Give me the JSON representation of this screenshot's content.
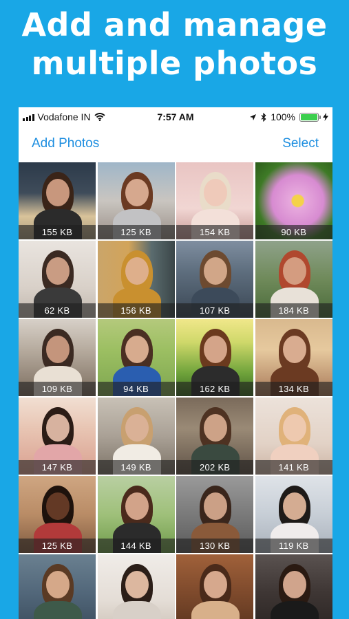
{
  "headline": {
    "line1": "Add and manage",
    "line2": "multiple photos"
  },
  "status_bar": {
    "carrier": "Vodafone IN",
    "time": "7:57 AM",
    "battery": "100%"
  },
  "nav": {
    "left_label": "Add Photos",
    "right_label": "Select"
  },
  "photos": [
    {
      "size": "155 KB",
      "bg": "linear-gradient(180deg,#2c3a4a 0%,#3f4c5a 40%,#d9c39a 70%,#a89a7c 100%)",
      "skin": "#d8a488",
      "hair": "#3a2418",
      "top": "#2b2b2b"
    },
    {
      "size": "125 KB",
      "bg": "linear-gradient(180deg,#9fb6c8 0%,#c9c5c0 50%,#9a8f88 100%)",
      "skin": "#e2b59a",
      "hair": "#6b3a22",
      "top": "#c2c2c4"
    },
    {
      "size": "154 KB",
      "bg": "linear-gradient(180deg,#e9c5c3 0%,#f1d6d3 60%,#c79a96 100%)",
      "skin": "#f0c8b8",
      "hair": "#e9dcc9",
      "top": "#f3e0d9"
    },
    {
      "size": "90 KB",
      "bg": "radial-gradient(circle at 55% 50%,#f4d24a 0%,#f4d24a 10%,#e7a9dd 12%,#d78bd1 45%,#3e7a26 70%,#2c5c1a 100%)",
      "skin": "",
      "hair": "",
      "top": ""
    },
    {
      "size": "62 KB",
      "bg": "linear-gradient(180deg,#e9e4df 0%,#d9d1c9 60%,#c1b8ae 100%)",
      "skin": "#d9a98e",
      "hair": "#3b2a22",
      "top": "#3a3a3a"
    },
    {
      "size": "156 KB",
      "bg": "linear-gradient(90deg,#caa56a 0%,#d2a45a 40%,#5a6b6e 70%,#3b4648 100%)",
      "skin": "#e0b396",
      "hair": "#c9902f",
      "top": "#c9902f"
    },
    {
      "size": "107 KB",
      "bg": "linear-gradient(180deg,#7f8ea0 0%,#5e6e7e 40%,#3a4654 100%)",
      "skin": "#dcb092",
      "hair": "#6d4a30",
      "top": "#3c4a5a"
    },
    {
      "size": "184 KB",
      "bg": "linear-gradient(180deg,#8fa28a 0%,#6f8a5a 50%,#4a6a3a 100%)",
      "skin": "#d8a58a",
      "hair": "#b0482e",
      "top": "#e8e1d8"
    },
    {
      "size": "109 KB",
      "bg": "linear-gradient(180deg,#d7d0c8 0%,#b6ab9e 40%,#7b6c5e 100%)",
      "skin": "#d4a186",
      "hair": "#3b2a22",
      "top": "#e9e0d4"
    },
    {
      "size": "94 KB",
      "bg": "linear-gradient(180deg,#b4c97c 0%,#9cbf62 40%,#7ea650 100%)",
      "skin": "#e7b99a",
      "hair": "#4a2f22",
      "top": "#2a5eb0"
    },
    {
      "size": "162 KB",
      "bg": "linear-gradient(180deg,#f0e78a 0%,#cfd86a 30%,#6fa33b 70%,#3d6a22 100%)",
      "skin": "#e0b095",
      "hair": "#6b3a1e",
      "top": "#2c2c2c"
    },
    {
      "size": "134 KB",
      "bg": "linear-gradient(180deg,#d9b98e 0%,#e6c99e 40%,#a77858 100%)",
      "skin": "#e6b99c",
      "hair": "#6b3a22",
      "top": "#6b3a22"
    },
    {
      "size": "147 KB",
      "bg": "linear-gradient(180deg,#f1dfd2 0%,#e8c5b3 40%,#d99f8f 100%)",
      "skin": "#eac3ae",
      "hair": "#2b1c16",
      "top": "#e2a6a8"
    },
    {
      "size": "149 KB",
      "bg": "linear-gradient(180deg,#c8c1b6 0%,#aaa196 50%,#7b7266 100%)",
      "skin": "#dcb29a",
      "hair": "#c8a070",
      "top": "#f1ece4"
    },
    {
      "size": "202 KB",
      "bg": "linear-gradient(180deg,#7a6a5a 0%,#9a8a76 40%,#5f5246 100%)",
      "skin": "#dcae92",
      "hair": "#4e3222",
      "top": "#3a4a40"
    },
    {
      "size": "141 KB",
      "bg": "linear-gradient(180deg,#ece2da 0%,#e2d2c6 60%,#cbb3a3 100%)",
      "skin": "#f0cbb5",
      "hair": "#e0b27a",
      "top": "#f0d0c0"
    },
    {
      "size": "125 KB",
      "bg": "linear-gradient(180deg,#cfa682 0%,#b98c66 50%,#7f5a40 100%)",
      "skin": "#6a3e28",
      "hair": "#1e120c",
      "top": "#b23a3a"
    },
    {
      "size": "144 KB",
      "bg": "linear-gradient(180deg,#b9cfa2 0%,#9fc07a 50%,#6e9a4a 100%)",
      "skin": "#e1b096",
      "hair": "#4a2a1c",
      "top": "#2b2b2b"
    },
    {
      "size": "130 KB",
      "bg": "linear-gradient(180deg,#9a9a9a 0%,#7a7a7a 50%,#5a5a5a 100%)",
      "skin": "#dcae92",
      "hair": "#3a261c",
      "top": "#8a5a3a"
    },
    {
      "size": "119 KB",
      "bg": "linear-gradient(180deg,#dfe3e8 0%,#c7ced6 50%,#a8b0ba 100%)",
      "skin": "#e8bca0",
      "hair": "#1e1a18",
      "top": "#f0ecec"
    },
    {
      "size": "",
      "bg": "linear-gradient(180deg,#6a8090 0%,#52677a 50%,#3a4c5c 100%)",
      "skin": "#e2b595",
      "hair": "#5a3a24",
      "top": "#3e5a4a"
    },
    {
      "size": "",
      "bg": "linear-gradient(180deg,#f0ece8 0%,#e4ddd6 60%,#cdc3b8 100%)",
      "skin": "#f0c8ae",
      "hair": "#2b1e18",
      "top": "#d8d0c8"
    },
    {
      "size": "",
      "bg": "linear-gradient(180deg,#a0613a 0%,#7e4a2c 50%,#5a341e 100%)",
      "skin": "#e6b69a",
      "hair": "#4a2a1a",
      "top": "#d8b08a"
    },
    {
      "size": "",
      "bg": "linear-gradient(180deg,#5a5250 0%,#3e3634 50%,#2a2422 100%)",
      "skin": "#e2b49a",
      "hair": "#2a1a12",
      "top": "#1a1a1a"
    }
  ]
}
